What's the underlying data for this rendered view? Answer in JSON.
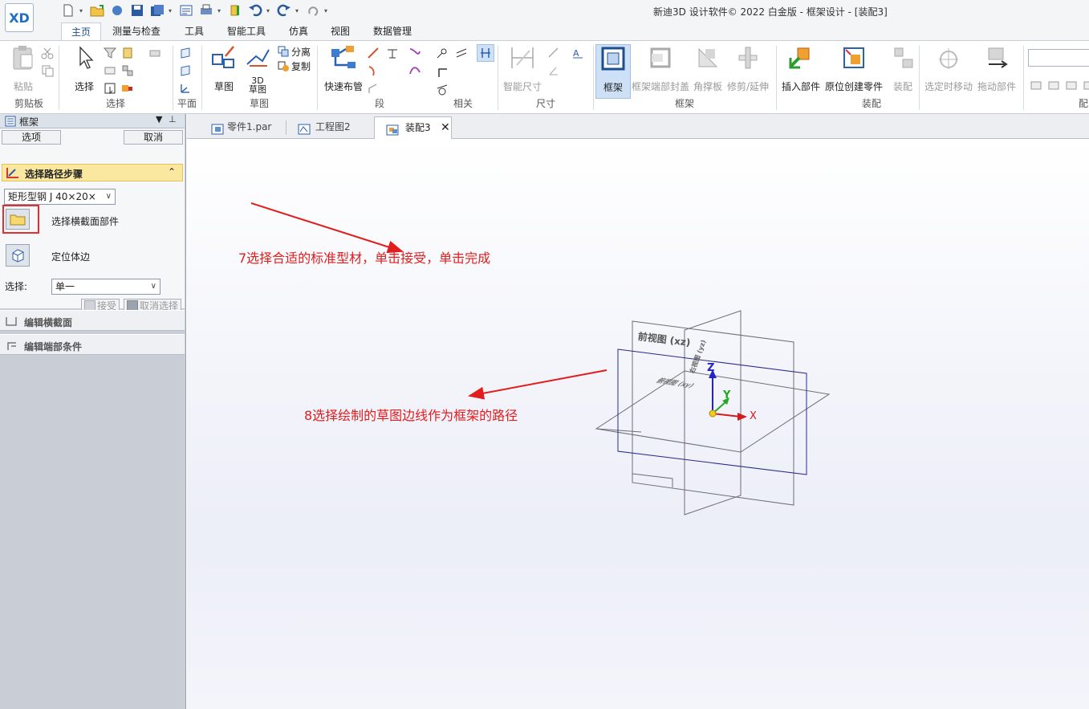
{
  "app": {
    "logo_text": "XD",
    "window_title": "新迪3D 设计软件© 2022 白金版 - 框架设计 - [装配3]"
  },
  "qat": {
    "icons": [
      "new-icon",
      "open-icon",
      "save-icon",
      "undo-icon",
      "redo-icon"
    ]
  },
  "ribbon_tabs": [
    "主页",
    "测量与检查",
    "工具",
    "智能工具",
    "仿真",
    "视图",
    "数据管理"
  ],
  "ribbon": {
    "clipboard": {
      "paste": "粘贴",
      "group": "剪贴板"
    },
    "select": {
      "select": "选择",
      "group": "选择"
    },
    "plane": {
      "group": "平面"
    },
    "sketch": {
      "sketch": "草图",
      "sketch3d_top": "3D",
      "sketch3d_bottom": "草图",
      "separate": "分离",
      "copy": "复制",
      "group": "草图"
    },
    "segment": {
      "quick_pipe": "快速布管",
      "group": "段"
    },
    "related": {
      "group": "相关"
    },
    "dimension": {
      "smart_dim": "智能尺寸",
      "group": "尺寸"
    },
    "frame": {
      "frame": "框架",
      "end_cap": "框架端部封盖",
      "gusset": "角撑板",
      "trim": "修剪/延伸",
      "group": "框架"
    },
    "assemble": {
      "insert": "插入部件",
      "create_in_place": "原位创建零件",
      "assemble": "装配",
      "group": "装配"
    },
    "move": {
      "move_selected": "选定时移动",
      "drag": "拖动部件"
    },
    "config": {
      "group": "配"
    }
  },
  "left_panel": {
    "title": "框架",
    "options_btn": "选项",
    "cancel_btn": "取消",
    "step_title": "选择路径步骤",
    "profile_dropdown": "矩形型钢 J 40×20×",
    "select_cross_section": "选择横截面部件",
    "locate_edge": "定位体边",
    "select_label": "选择:",
    "select_value": "单一",
    "accept_btn": "接受",
    "deselect_btn": "取消选择",
    "edit_cross_section": "编辑横截面",
    "edit_end_conditions": "编辑端部条件"
  },
  "doc_tabs": [
    {
      "label": "零件1.par"
    },
    {
      "label": "工程图2"
    },
    {
      "label": "装配3"
    }
  ],
  "canvas": {
    "front_view_label": "前视图 (xz)",
    "right_view_label": "右视图 (yz)",
    "top_view_label": "俯视图 (xy)",
    "axis_x": "X",
    "axis_y": "Y",
    "axis_z": "Z",
    "annotation_7": "7选择合适的标准型材，单击接受，单击完成",
    "annotation_8": "8选择绘制的草图边线作为框架的路径"
  },
  "colors": {
    "accent": "#1c4f8f",
    "annotation_red": "#e11d1d",
    "step_bar": "#fbe8a0",
    "plane_blue": "#2a2a8a",
    "plane_gray": "#6a6a7a"
  }
}
